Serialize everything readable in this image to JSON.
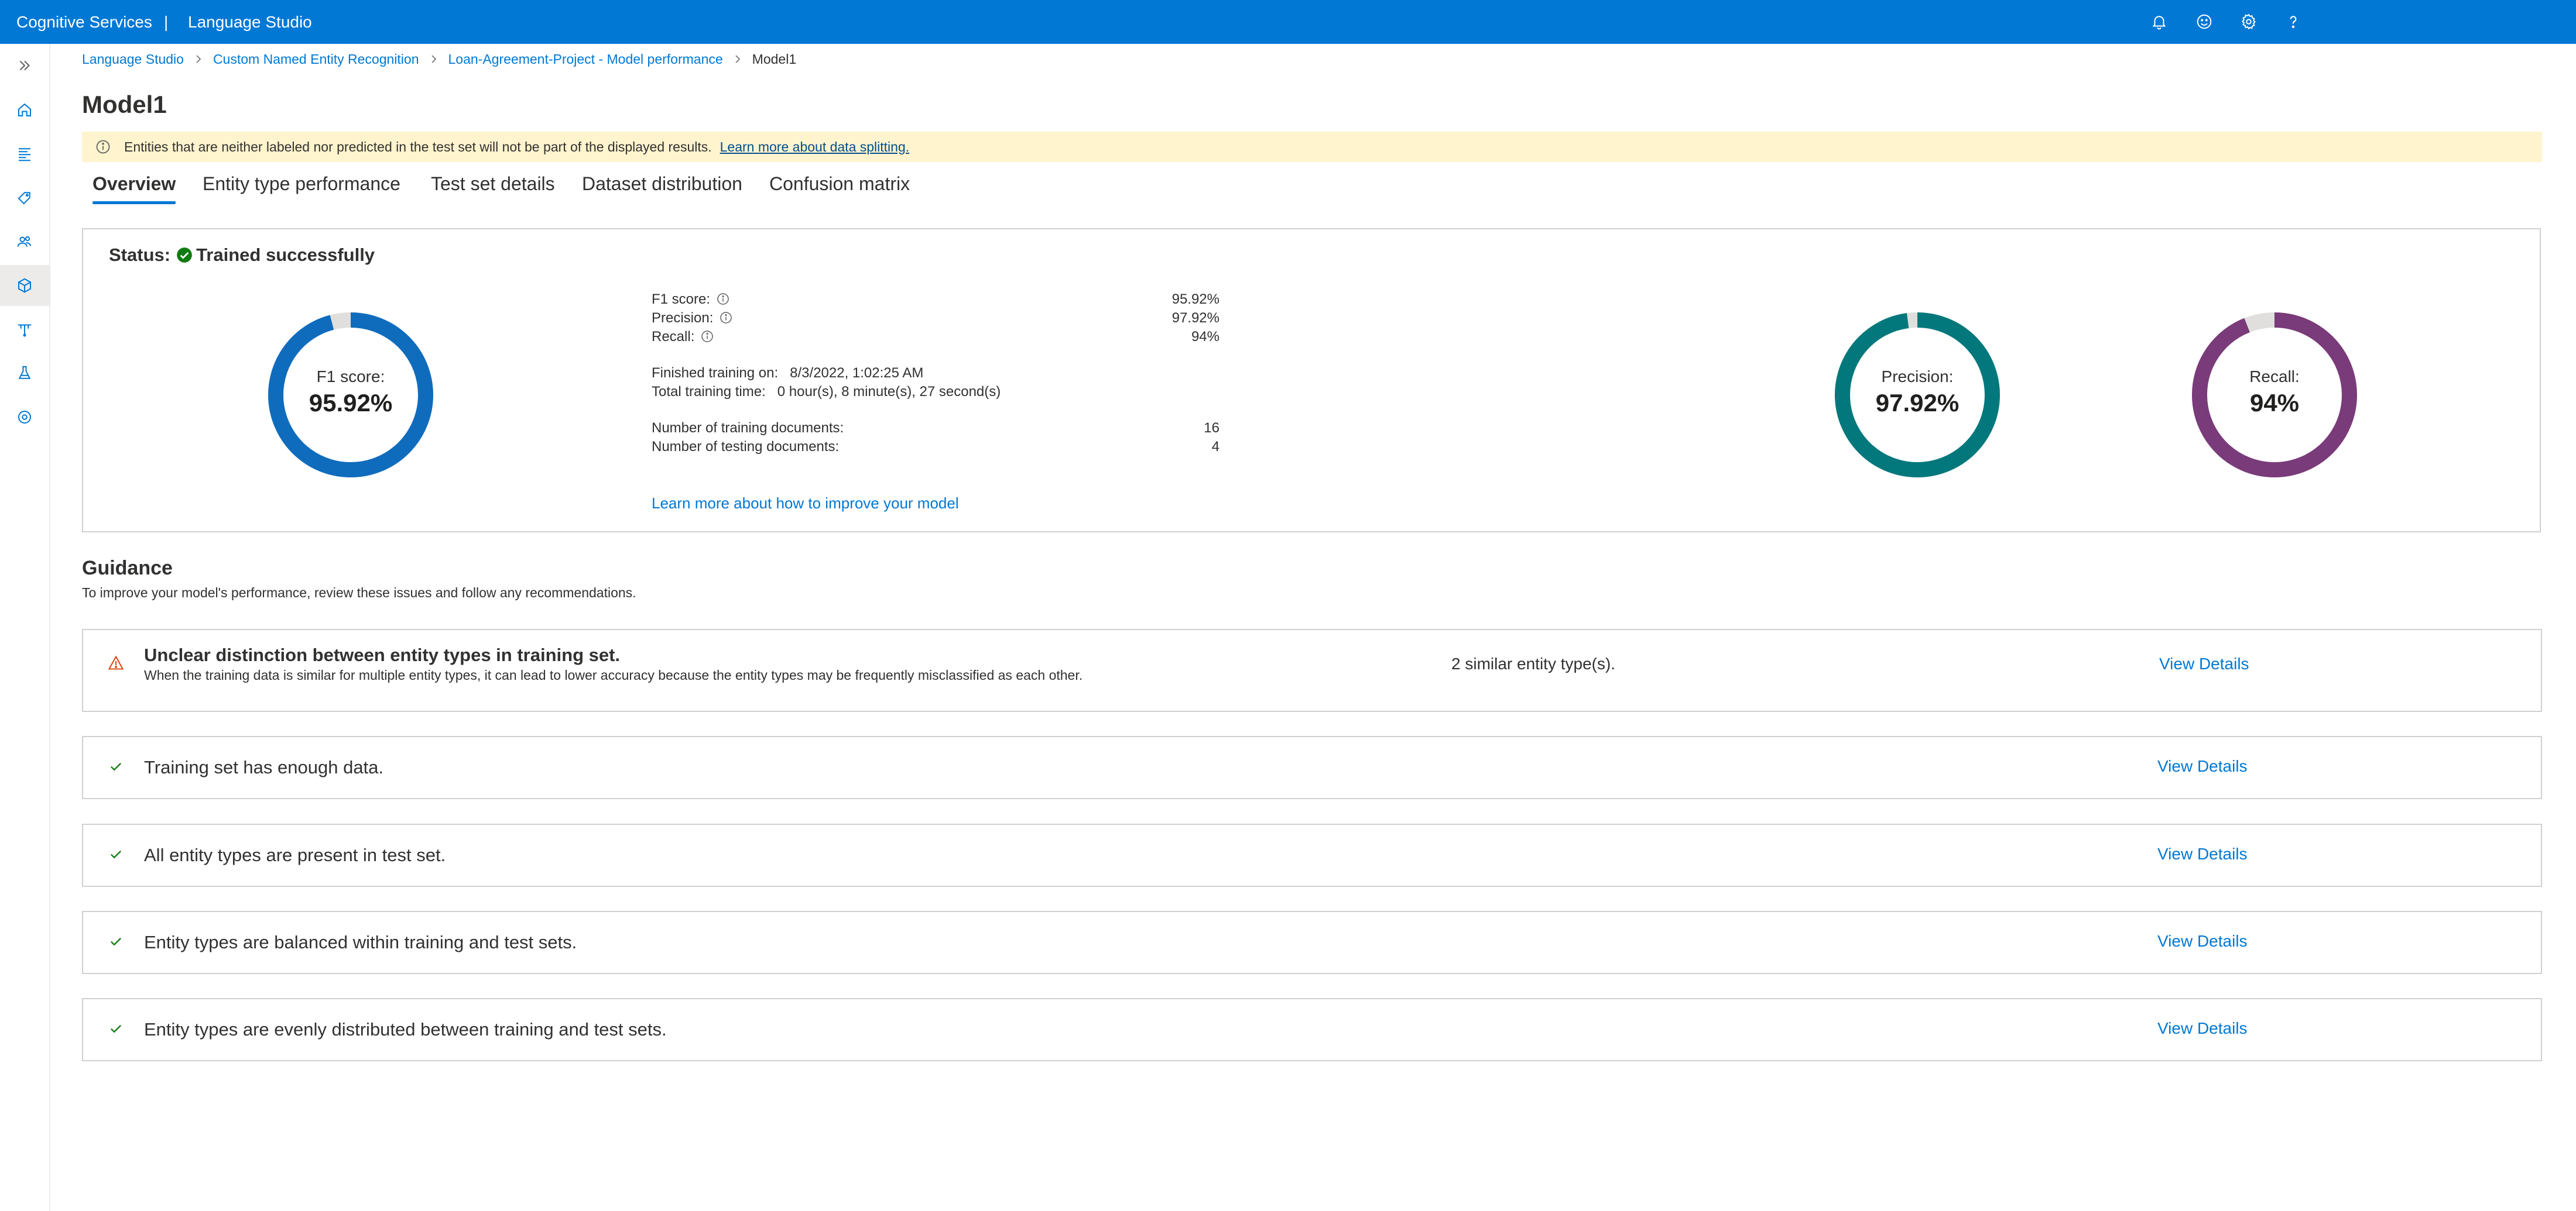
{
  "topbar": {
    "brand": "Cognitive Services",
    "separator": "|",
    "product": "Language Studio",
    "icons": [
      "bell-icon",
      "smiley-icon",
      "gear-icon",
      "help-icon"
    ]
  },
  "rail": {
    "icons": [
      "expand-icon",
      "home-icon",
      "list-icon",
      "tag-icon",
      "users-icon",
      "model-icon",
      "deploy-icon",
      "flask-icon",
      "settings-icon"
    ],
    "active_index": 5
  },
  "breadcrumb": [
    "Language Studio",
    "Custom Named Entity Recognition",
    "Loan-Agreement-Project - Model performance",
    "Model1"
  ],
  "page_title": "Model1",
  "notice": {
    "text": "Entities that are neither labeled nor predicted in the test set will not be part of the displayed results.",
    "link": "Learn more about data splitting."
  },
  "tabs": [
    "Overview",
    "Entity type performance",
    "Test set details",
    "Dataset distribution",
    "Confusion matrix"
  ],
  "active_tab": 0,
  "overview": {
    "status_label": "Status:",
    "status_value": "Trained successfully",
    "f1": {
      "label": "F1 score:",
      "value": "95.92%",
      "fraction": 0.9592,
      "color": "#0f6cbd"
    },
    "precision": {
      "label": "Precision:",
      "value": "97.92%",
      "fraction": 0.9792,
      "color": "#03787c"
    },
    "recall": {
      "label": "Recall:",
      "value": "94%",
      "fraction": 0.94,
      "color": "#7a3b7a"
    },
    "metrics": [
      {
        "label": "F1 score:",
        "value": "95.92%"
      },
      {
        "label": "Precision:",
        "value": "97.92%"
      },
      {
        "label": "Recall:",
        "value": "94%"
      }
    ],
    "finished_label": "Finished training on:",
    "finished_value": "8/3/2022, 1:02:25 AM",
    "total_label": "Total training time:",
    "total_value": "0 hour(s), 8 minute(s), 27 second(s)",
    "train_docs_label": "Number of training documents:",
    "train_docs_value": "16",
    "test_docs_label": "Number of testing documents:",
    "test_docs_value": "4",
    "improve_link": "Learn more about how to improve your model"
  },
  "guidance": {
    "title": "Guidance",
    "subtitle": "To improve your model's performance, review these issues and follow any recommendations.",
    "items": [
      {
        "type": "warning",
        "title": "Unclear distinction between entity types in training set.",
        "description": "When the training data is similar for multiple entity types, it can lead to lower accuracy because the entity types may be frequently misclassified as each other.",
        "detail": "2 similar entity type(s).",
        "action": "View Details"
      },
      {
        "type": "ok",
        "title": "Training set has enough data.",
        "action": "View Details"
      },
      {
        "type": "ok",
        "title": "All entity types are present in test set.",
        "action": "View Details"
      },
      {
        "type": "ok",
        "title": "Entity types are balanced within training and test sets.",
        "action": "View Details"
      },
      {
        "type": "ok",
        "title": "Entity types are evenly distributed between training and test sets.",
        "action": "View Details"
      }
    ]
  }
}
